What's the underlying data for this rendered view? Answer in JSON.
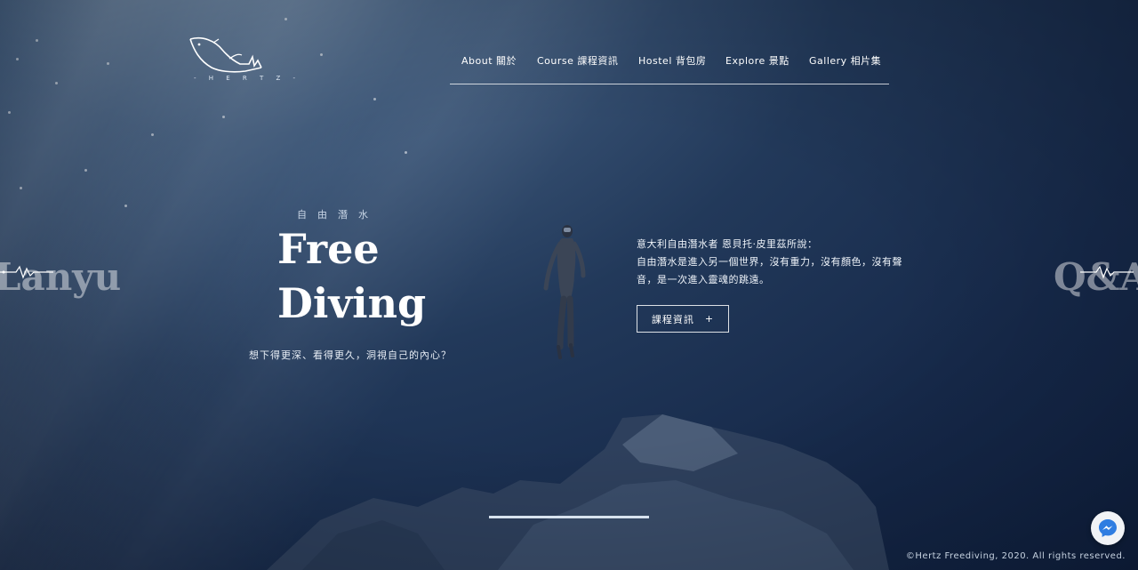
{
  "brand": {
    "logo_text": "- H E R T Z -"
  },
  "nav": {
    "items": [
      {
        "label": "About 關於"
      },
      {
        "label": "Course 課程資訊"
      },
      {
        "label": "Hostel 背包房"
      },
      {
        "label": "Explore 景點"
      },
      {
        "label": "Gallery 相片集"
      }
    ]
  },
  "hero": {
    "eyebrow": "自由潛水",
    "title_line1": "Free",
    "title_line2": "Diving",
    "subtitle": "想下得更深、看得更久，洞視自己的內心？",
    "quote_line1": "意大利自由潛水者 恩貝托·皮里茲所說：",
    "quote_line2": "自由潛水是進入另一個世界，沒有重力，沒有顏色，沒有聲音，是一次進入靈魂的跳遠。",
    "cta_label": "課程資訊",
    "cta_icon": "+"
  },
  "side_tabs": {
    "left": "Lanyu",
    "right": "Q&A"
  },
  "footer": {
    "copyright": "©Hertz Freediving, 2020. All rights reserved."
  },
  "colors": {
    "deep": "#0f2040",
    "mid": "#22395a",
    "surface": "#6f89a6"
  },
  "slider": {
    "progress": 1.0
  }
}
